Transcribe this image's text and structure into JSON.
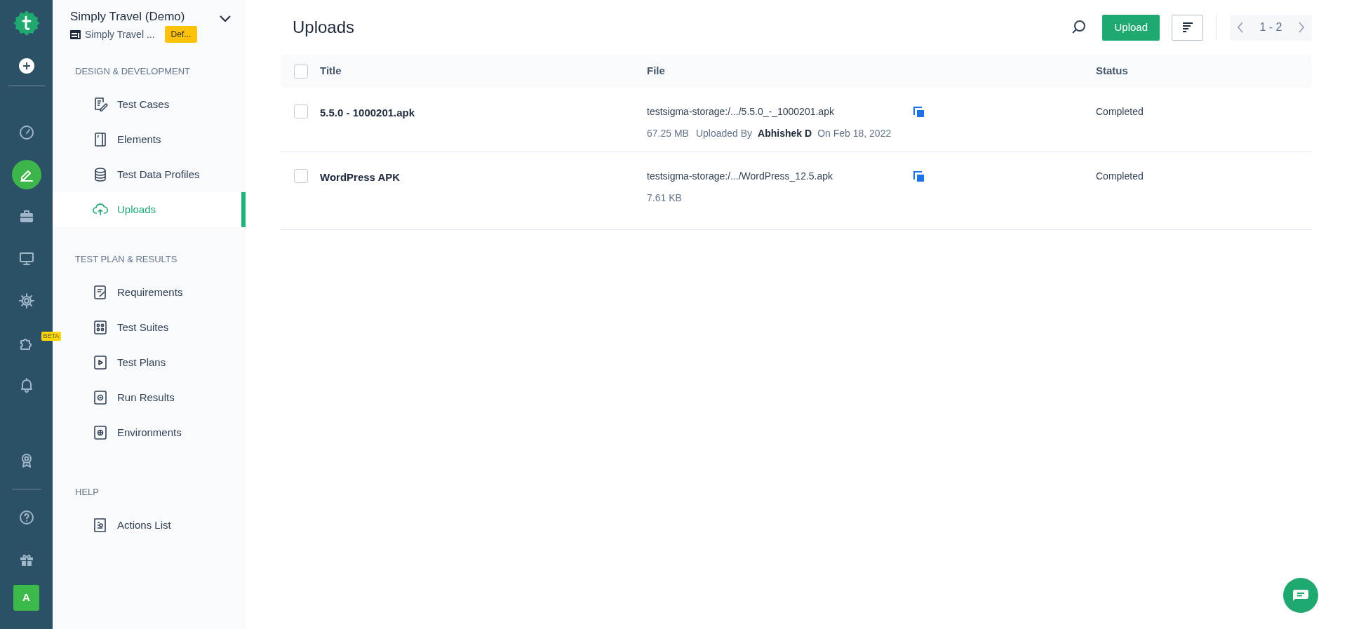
{
  "rail": {
    "items": [
      {
        "selected": false
      },
      {
        "selected": true
      },
      {
        "selected": false
      },
      {
        "selected": false
      },
      {
        "selected": false
      },
      {
        "selected": false,
        "badge": "BETA"
      },
      {
        "selected": false
      },
      {
        "selected": false
      }
    ],
    "bottom": [
      {
        "selected": false
      },
      {
        "selected": false
      }
    ],
    "avatar": "A"
  },
  "workspace": {
    "name": "Simply Travel (Demo)",
    "project": "Simply Travel ...",
    "tag": "Def..."
  },
  "sidebar": {
    "sections": [
      {
        "heading": "DESIGN & DEVELOPMENT",
        "items": [
          {
            "label": "Test Cases",
            "selected": false
          },
          {
            "label": "Elements",
            "selected": false
          },
          {
            "label": "Test Data Profiles",
            "selected": false
          },
          {
            "label": "Uploads",
            "selected": true
          }
        ]
      },
      {
        "heading": "TEST PLAN & RESULTS",
        "items": [
          {
            "label": "Requirements",
            "selected": false
          },
          {
            "label": "Test Suites",
            "selected": false
          },
          {
            "label": "Test Plans",
            "selected": false
          },
          {
            "label": "Run Results",
            "selected": false
          },
          {
            "label": "Environments",
            "selected": false
          }
        ]
      },
      {
        "heading": "HELP",
        "items": [
          {
            "label": "Actions List",
            "selected": false
          }
        ]
      }
    ]
  },
  "page": {
    "title": "Uploads",
    "upload_button": "Upload",
    "pagination": "1 - 2"
  },
  "table": {
    "all_checked": false,
    "columns": [
      "Title",
      "File",
      "Status"
    ],
    "rows": [
      {
        "checked": false,
        "title": "5.5.0 - 1000201.apk",
        "file": "testsigma-storage:/.../5.5.0_-_1000201.apk",
        "size": "67.25 MB",
        "uploaded_by_label": "Uploaded By",
        "uploader": "Abhishek D",
        "date": "On Feb 18, 2022",
        "status": "Completed"
      },
      {
        "checked": false,
        "title": "WordPress APK",
        "file": "testsigma-storage:/.../WordPress_12.5.apk",
        "size": "7.61 KB",
        "status": "Completed"
      }
    ]
  }
}
